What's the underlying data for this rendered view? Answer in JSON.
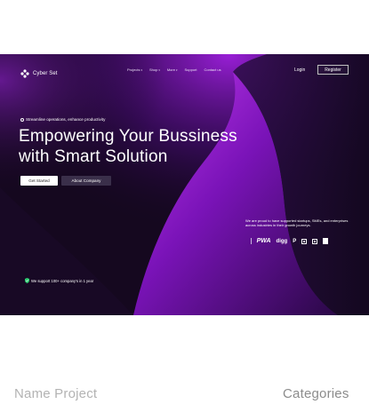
{
  "brand": {
    "name": "Cyber Set"
  },
  "nav": {
    "items": [
      {
        "label": "Projects",
        "has_dropdown": true
      },
      {
        "label": "Shop",
        "has_dropdown": true
      },
      {
        "label": "More",
        "has_dropdown": true
      },
      {
        "label": "Support",
        "has_dropdown": false
      },
      {
        "label": "Contact us",
        "has_dropdown": false
      }
    ],
    "login_label": "Login",
    "register_label": "Register"
  },
  "hero": {
    "tagline": "Streamline operations, enhance productivity",
    "headline_line1": "Empowering Your Bussiness",
    "headline_line2": "with Smart Solution",
    "primary_button": "Get Started",
    "secondary_button": "About Company",
    "support_text": "We are proud to have supported startups, SMEs, and enterprises across industries in their growth journeys.",
    "partners": [
      "PWA",
      "digg",
      "P",
      "K",
      "J",
      "V"
    ],
    "badge_text": "We support 100+ company's in 1 year"
  },
  "sections": {
    "left_heading": "Name Project",
    "right_heading": "Categories"
  },
  "colors": {
    "hero_dark": "#12061f",
    "accent_purple": "#9b1fd6",
    "badge_green": "#2ecc71"
  }
}
